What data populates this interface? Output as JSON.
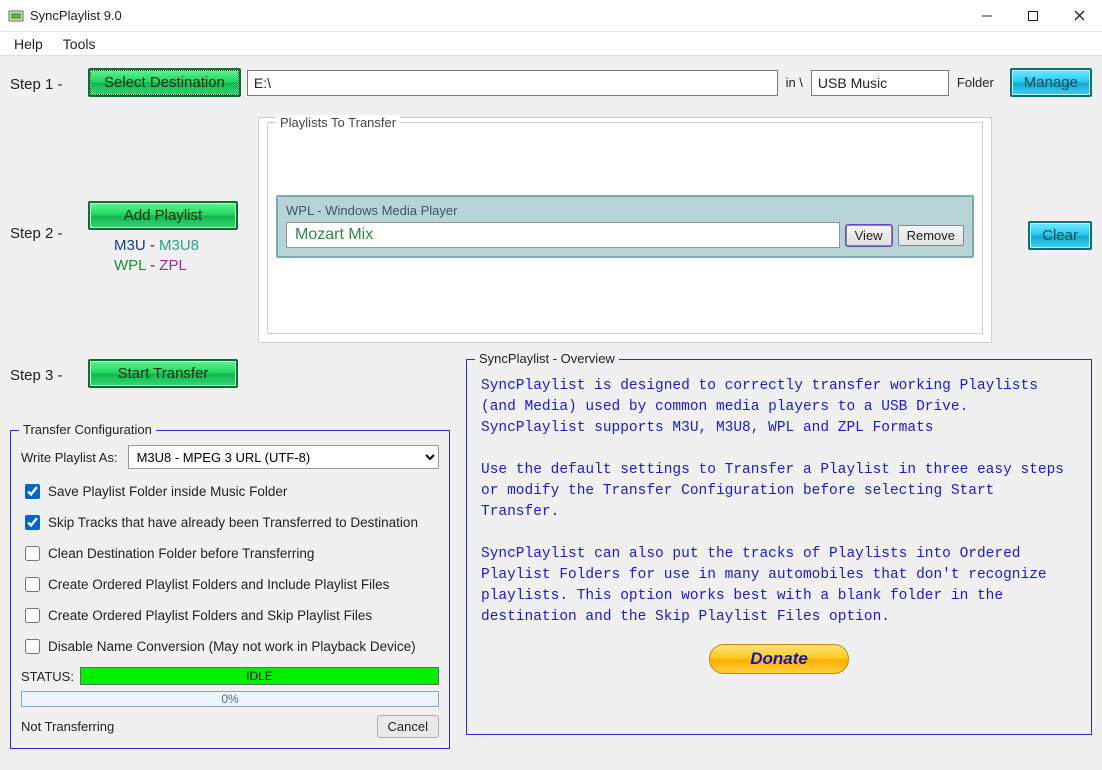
{
  "window": {
    "title": "SyncPlaylist 9.0"
  },
  "menu": {
    "help": "Help",
    "tools": "Tools"
  },
  "step1": {
    "label": "Step 1 -",
    "select_dest": "Select Destination",
    "path": "E:\\",
    "in_sep": "in \\",
    "folder_name": "USB Music",
    "folder_label": "Folder",
    "manage": "Manage"
  },
  "step2": {
    "label": "Step 2 -",
    "add_playlist": "Add Playlist",
    "fmt_m3u": "M3U",
    "fmt_dash": " - ",
    "fmt_m3u8": "M3U8",
    "fmt_wpl": "WPL",
    "fmt_dash2": "  -  ",
    "fmt_zpl": "ZPL",
    "group_title": "Playlists To Transfer",
    "wpl_title": "WPL - Windows Media Player",
    "playlist_name": "Mozart Mix",
    "view": "View",
    "remove": "Remove",
    "clear": "Clear"
  },
  "step3": {
    "label": "Step 3 -",
    "start_transfer": "Start Transfer"
  },
  "config": {
    "legend": "Transfer Configuration",
    "write_label": "Write Playlist As:",
    "write_value": "M3U8 - MPEG 3 URL (UTF-8)",
    "opt_save_inside": "Save Playlist Folder inside Music Folder",
    "opt_skip_tracks": "Skip Tracks that have already been Transferred to Destination",
    "opt_clean": "Clean Destination Folder before Transferring",
    "opt_ordered_include": "Create Ordered Playlist Folders and Include Playlist Files",
    "opt_ordered_skip": "Create Ordered Playlist Folders and Skip Playlist Files",
    "opt_disable_conv": "Disable Name Conversion (May not work in Playback Device)",
    "status_label": "STATUS:",
    "status_value": "IDLE",
    "progress": "0%",
    "not_transferring": "Not Transferring",
    "cancel": "Cancel",
    "checked": {
      "save_inside": true,
      "skip_tracks": true,
      "clean": false,
      "ordered_include": false,
      "ordered_skip": false,
      "disable_conv": false
    }
  },
  "overview": {
    "legend": "SyncPlaylist - Overview",
    "p1": "SyncPlaylist is designed to correctly transfer working Playlists (and Media) used by common media players to a USB Drive. SyncPlaylist supports M3U, M3U8, WPL and ZPL Formats",
    "p2": "Use the default settings to Transfer a Playlist in three easy steps or modify the Transfer Configuration before selecting Start Transfer.",
    "p3": "SyncPlaylist can also put the tracks of Playlists into Ordered Playlist Folders for use in many automobiles that don't recognize playlists. This option works best with a blank folder in the destination and the Skip Playlist Files option.",
    "donate": "Donate"
  }
}
